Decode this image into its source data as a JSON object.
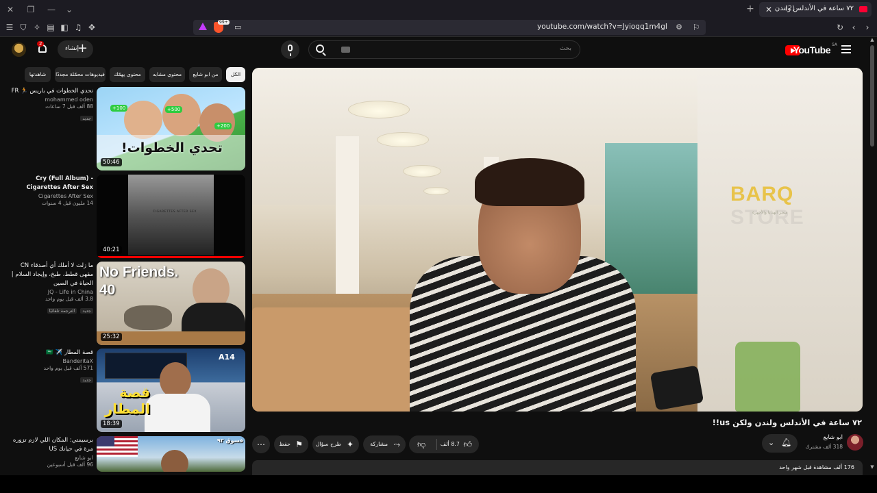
{
  "browser": {
    "tab_title": "٧٢ ساعة في الأندلس ولندن",
    "tab_audio": "(2)",
    "url": "youtube.com/watch?v=Jyioqq1m4gI",
    "shields_count": "99+"
  },
  "header": {
    "logo_text": "YouTube",
    "country": "SA",
    "search_placeholder": "بحث",
    "create_label": "إنشاء",
    "notifications_count": "2"
  },
  "chips": [
    "الكل",
    "من ابو شايع",
    "محتوى مشابه",
    "محتوى يهمّك",
    "فيديوهات محمّلة مجددًا",
    "شاهدتها"
  ],
  "related": [
    {
      "title": "تحدي الخطوات في باريس 🏃 FR",
      "channel": "mohammed oden",
      "stats": "88 ألف  قبل 7 ساعات",
      "badge": "جديد",
      "duration": "50:46"
    },
    {
      "title": "Cry (Full Album) - Cigarettes After Sex",
      "channel": "Cigarettes After Sex",
      "stats": "14 مليون  قبل 4 سنوات",
      "badge": "",
      "duration": "40:21"
    },
    {
      "title": "ما زلت لا أملك أي أصدقاء CN مقهى قطط، طبخ، وإيجاد السلام | الحياة في الصين",
      "channel": "JQ - Life in China",
      "stats": "3.8 ألف  قبل يوم واحد",
      "badge": "جديد",
      "extra": "الترجمة تلقائيًا",
      "duration": "25:32"
    },
    {
      "title": "قصة المطار ✈️ 🇸🇦",
      "channel": "BanderitaX",
      "stats": "571 ألف  قبل يوم واحد",
      "badge": "جديد",
      "duration": "18:39"
    },
    {
      "title": "برسيمتي: المكان اللي لازم تزوره مرة في حياتك US",
      "channel": "ابو شايع",
      "stats": "96 ألف  قبل أسبوعين",
      "badge": "",
      "duration": ""
    }
  ],
  "thumb_text": {
    "t1_big": "تحدي الخطوات!",
    "t1_tag1": "+100",
    "t1_tag2": "+500",
    "t1_tag3": "+200",
    "t2_small": "CIGARETTES AFTER SEX",
    "t3_big": "No Friends.",
    "t3_num": "40",
    "t4_big": "قصة المطار",
    "t4_gate": "A14",
    "t5_top": "فسوق ٩٢"
  },
  "player": {
    "watermark_a": "BARQ ",
    "watermark_b": "STORE",
    "watermark_sub": "متجر الهدايا والأجهزة"
  },
  "video": {
    "title": "٧٢ ساعة في الأندلس ولندن ولكن us!!",
    "channel_name": "ابو شايع",
    "subscribers": "318 ألف مشترك",
    "likes": "8.7 ألف",
    "share_label": "مشاركة",
    "ask_label": "طرح سؤال",
    "save_label": "حفظ",
    "description": "176 ألف مشاهدة  قبل شهر واحد"
  }
}
